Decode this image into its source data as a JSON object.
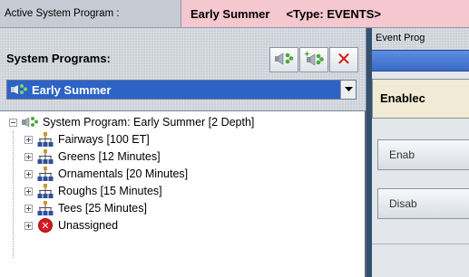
{
  "status_bar": {
    "label": "Active System Program :",
    "program_name": "Early Summer",
    "type_text": "<Type: EVENTS>"
  },
  "left_panel": {
    "title": "System Programs:",
    "buttons": [
      {
        "icon": "program-icon"
      },
      {
        "icon": "new-program-icon"
      },
      {
        "icon": "delete-icon"
      }
    ],
    "combo_value": "Early Summer"
  },
  "tree": {
    "root": "System Program: Early Summer  [2 Depth]",
    "items": [
      {
        "label": "Fairways  [100 ET]",
        "icon": "sprinkler-group-icon"
      },
      {
        "label": "Greens  [12 Minutes]",
        "icon": "sprinkler-group-icon"
      },
      {
        "label": "Ornamentals  [20 Minutes]",
        "icon": "sprinkler-group-icon"
      },
      {
        "label": "Roughs  [15 Minutes]",
        "icon": "sprinkler-group-icon"
      },
      {
        "label": "Tees  [25 Minutes]",
        "icon": "sprinkler-group-icon"
      },
      {
        "label": "Unassigned",
        "icon": "unassigned-icon"
      }
    ]
  },
  "right_panel": {
    "header": "Event Prog",
    "enabled_label": "Enablec",
    "enable_button": "Enab",
    "disable_button": "Disab"
  },
  "colors": {
    "status_highlight": "#f5c7cf",
    "combo_selection": "#2d63c6",
    "panel_blue": "#4a7bd4",
    "divider": "#33506e",
    "delete_red": "#d11818"
  }
}
